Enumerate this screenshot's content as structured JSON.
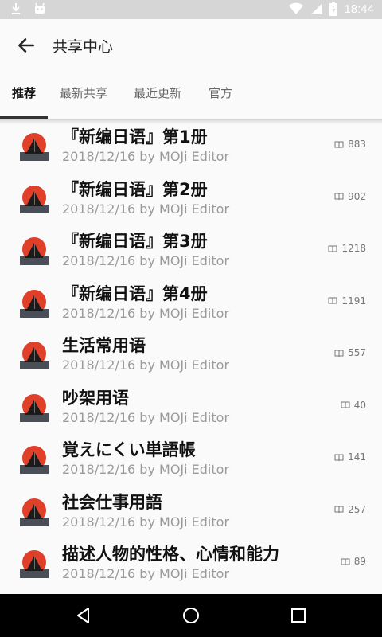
{
  "status_bar": {
    "time": "18:44"
  },
  "app_bar": {
    "title": "共享中心"
  },
  "tabs": [
    {
      "label": "推荐"
    },
    {
      "label": "最新共享"
    },
    {
      "label": "最近更新"
    },
    {
      "label": "官方"
    }
  ],
  "items": [
    {
      "title": "『新编日语』第1册",
      "subtitle": "2018/12/16 by MOJi Editor",
      "count": "883"
    },
    {
      "title": "『新编日语』第2册",
      "subtitle": "2018/12/16 by MOJi Editor",
      "count": "902"
    },
    {
      "title": "『新编日语』第3册",
      "subtitle": "2018/12/16 by MOJi Editor",
      "count": "1218"
    },
    {
      "title": "『新编日语』第4册",
      "subtitle": "2018/12/16 by MOJi Editor",
      "count": "1191"
    },
    {
      "title": "生活常用语",
      "subtitle": "2018/12/16 by MOJi Editor",
      "count": "557"
    },
    {
      "title": "吵架用语",
      "subtitle": "2018/12/16 by MOJi Editor",
      "count": "40"
    },
    {
      "title": "覚えにくい単語帳",
      "subtitle": "2018/12/16 by MOJi Editor",
      "count": "141"
    },
    {
      "title": "社会仕事用語",
      "subtitle": "2018/12/16 by MOJi Editor",
      "count": "257"
    },
    {
      "title": "描述人物的性格、心情和能力",
      "subtitle": "2018/12/16 by MOJi Editor",
      "count": "89"
    }
  ],
  "colors": {
    "logo_sun": "#e0402a",
    "logo_sea": "#4a4f57",
    "accent": "#333333"
  }
}
